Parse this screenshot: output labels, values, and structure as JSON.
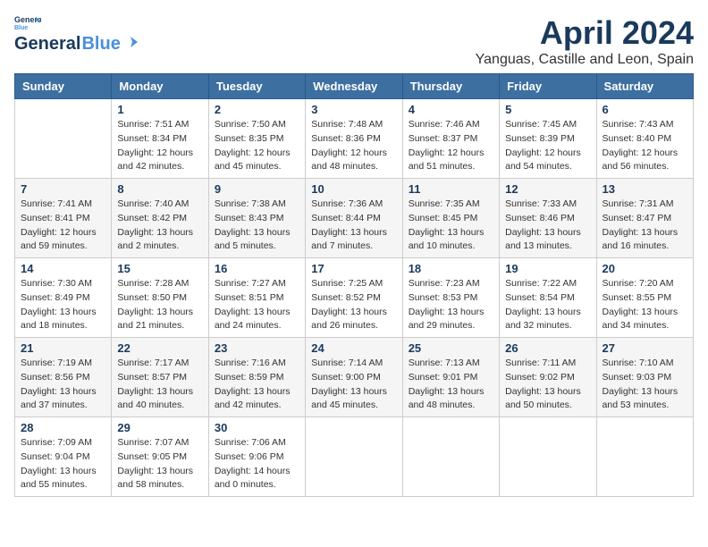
{
  "header": {
    "logo_line1": "General",
    "logo_line2": "Blue",
    "month": "April 2024",
    "location": "Yanguas, Castille and Leon, Spain"
  },
  "weekdays": [
    "Sunday",
    "Monday",
    "Tuesday",
    "Wednesday",
    "Thursday",
    "Friday",
    "Saturday"
  ],
  "weeks": [
    [
      {
        "day": "",
        "info": ""
      },
      {
        "day": "1",
        "info": "Sunrise: 7:51 AM\nSunset: 8:34 PM\nDaylight: 12 hours\nand 42 minutes."
      },
      {
        "day": "2",
        "info": "Sunrise: 7:50 AM\nSunset: 8:35 PM\nDaylight: 12 hours\nand 45 minutes."
      },
      {
        "day": "3",
        "info": "Sunrise: 7:48 AM\nSunset: 8:36 PM\nDaylight: 12 hours\nand 48 minutes."
      },
      {
        "day": "4",
        "info": "Sunrise: 7:46 AM\nSunset: 8:37 PM\nDaylight: 12 hours\nand 51 minutes."
      },
      {
        "day": "5",
        "info": "Sunrise: 7:45 AM\nSunset: 8:39 PM\nDaylight: 12 hours\nand 54 minutes."
      },
      {
        "day": "6",
        "info": "Sunrise: 7:43 AM\nSunset: 8:40 PM\nDaylight: 12 hours\nand 56 minutes."
      }
    ],
    [
      {
        "day": "7",
        "info": "Sunrise: 7:41 AM\nSunset: 8:41 PM\nDaylight: 12 hours\nand 59 minutes."
      },
      {
        "day": "8",
        "info": "Sunrise: 7:40 AM\nSunset: 8:42 PM\nDaylight: 13 hours\nand 2 minutes."
      },
      {
        "day": "9",
        "info": "Sunrise: 7:38 AM\nSunset: 8:43 PM\nDaylight: 13 hours\nand 5 minutes."
      },
      {
        "day": "10",
        "info": "Sunrise: 7:36 AM\nSunset: 8:44 PM\nDaylight: 13 hours\nand 7 minutes."
      },
      {
        "day": "11",
        "info": "Sunrise: 7:35 AM\nSunset: 8:45 PM\nDaylight: 13 hours\nand 10 minutes."
      },
      {
        "day": "12",
        "info": "Sunrise: 7:33 AM\nSunset: 8:46 PM\nDaylight: 13 hours\nand 13 minutes."
      },
      {
        "day": "13",
        "info": "Sunrise: 7:31 AM\nSunset: 8:47 PM\nDaylight: 13 hours\nand 16 minutes."
      }
    ],
    [
      {
        "day": "14",
        "info": "Sunrise: 7:30 AM\nSunset: 8:49 PM\nDaylight: 13 hours\nand 18 minutes."
      },
      {
        "day": "15",
        "info": "Sunrise: 7:28 AM\nSunset: 8:50 PM\nDaylight: 13 hours\nand 21 minutes."
      },
      {
        "day": "16",
        "info": "Sunrise: 7:27 AM\nSunset: 8:51 PM\nDaylight: 13 hours\nand 24 minutes."
      },
      {
        "day": "17",
        "info": "Sunrise: 7:25 AM\nSunset: 8:52 PM\nDaylight: 13 hours\nand 26 minutes."
      },
      {
        "day": "18",
        "info": "Sunrise: 7:23 AM\nSunset: 8:53 PM\nDaylight: 13 hours\nand 29 minutes."
      },
      {
        "day": "19",
        "info": "Sunrise: 7:22 AM\nSunset: 8:54 PM\nDaylight: 13 hours\nand 32 minutes."
      },
      {
        "day": "20",
        "info": "Sunrise: 7:20 AM\nSunset: 8:55 PM\nDaylight: 13 hours\nand 34 minutes."
      }
    ],
    [
      {
        "day": "21",
        "info": "Sunrise: 7:19 AM\nSunset: 8:56 PM\nDaylight: 13 hours\nand 37 minutes."
      },
      {
        "day": "22",
        "info": "Sunrise: 7:17 AM\nSunset: 8:57 PM\nDaylight: 13 hours\nand 40 minutes."
      },
      {
        "day": "23",
        "info": "Sunrise: 7:16 AM\nSunset: 8:59 PM\nDaylight: 13 hours\nand 42 minutes."
      },
      {
        "day": "24",
        "info": "Sunrise: 7:14 AM\nSunset: 9:00 PM\nDaylight: 13 hours\nand 45 minutes."
      },
      {
        "day": "25",
        "info": "Sunrise: 7:13 AM\nSunset: 9:01 PM\nDaylight: 13 hours\nand 48 minutes."
      },
      {
        "day": "26",
        "info": "Sunrise: 7:11 AM\nSunset: 9:02 PM\nDaylight: 13 hours\nand 50 minutes."
      },
      {
        "day": "27",
        "info": "Sunrise: 7:10 AM\nSunset: 9:03 PM\nDaylight: 13 hours\nand 53 minutes."
      }
    ],
    [
      {
        "day": "28",
        "info": "Sunrise: 7:09 AM\nSunset: 9:04 PM\nDaylight: 13 hours\nand 55 minutes."
      },
      {
        "day": "29",
        "info": "Sunrise: 7:07 AM\nSunset: 9:05 PM\nDaylight: 13 hours\nand 58 minutes."
      },
      {
        "day": "30",
        "info": "Sunrise: 7:06 AM\nSunset: 9:06 PM\nDaylight: 14 hours\nand 0 minutes."
      },
      {
        "day": "",
        "info": ""
      },
      {
        "day": "",
        "info": ""
      },
      {
        "day": "",
        "info": ""
      },
      {
        "day": "",
        "info": ""
      }
    ]
  ]
}
